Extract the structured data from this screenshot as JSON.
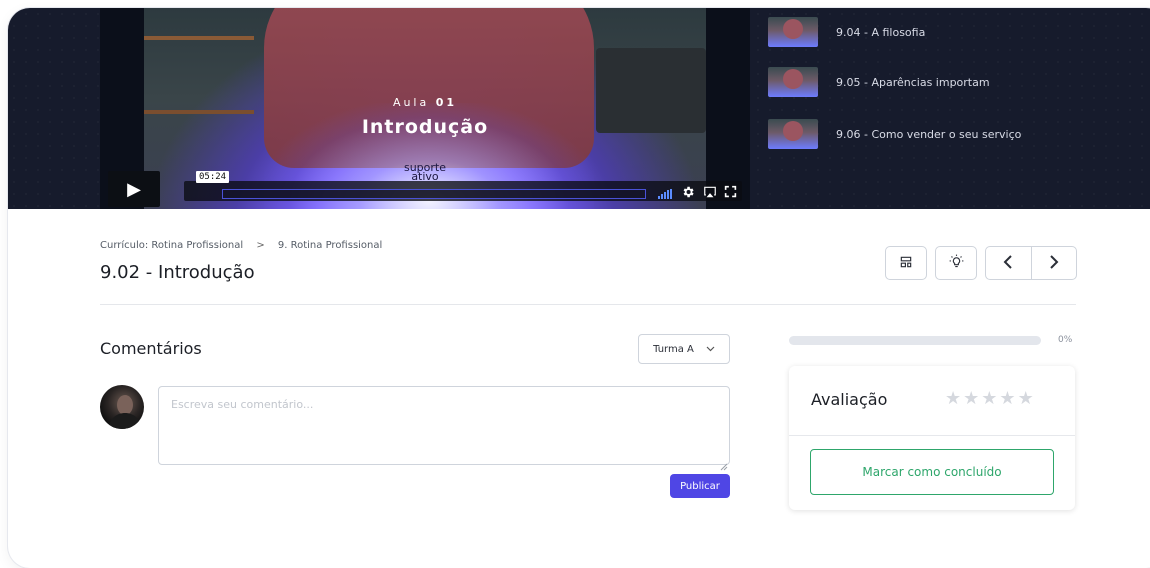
{
  "video": {
    "aula_label": "Aula",
    "aula_number": "01",
    "title_overlay": "Introdução",
    "brand_line1": "suporte",
    "brand_line2": "ativo",
    "current_time": "05:24",
    "icons": [
      "play-icon",
      "volume-icon",
      "settings-icon",
      "airplay-icon",
      "fullscreen-icon"
    ]
  },
  "playlist": [
    {
      "label": "9.04 - A filosofia"
    },
    {
      "label": "9.05 - Aparências importam"
    },
    {
      "label": "9.06 - Como vender o seu serviço"
    }
  ],
  "breadcrumb": {
    "part1": "Currículo: Rotina Profissional",
    "separator": ">",
    "part2": "9. Rotina Profissional"
  },
  "lesson": {
    "title": "9.02 - Introdução"
  },
  "toolbar": {
    "icons": [
      "layout-icon",
      "lightbulb-icon",
      "chevron-left-icon",
      "chevron-right-icon"
    ]
  },
  "comments": {
    "title": "Comentários",
    "turma_selected": "Turma A",
    "placeholder": "Escreva seu comentário...",
    "value": "",
    "publish_label": "Publicar"
  },
  "progress": {
    "percent": 0,
    "label": "0%"
  },
  "evaluation": {
    "title": "Avaliação",
    "stars_total": 5,
    "rating": 0,
    "complete_label": "Marcar como concluído"
  },
  "colors": {
    "accent": "#4f46e5",
    "success": "#2ea66b",
    "header_bg": "#161b2c"
  }
}
